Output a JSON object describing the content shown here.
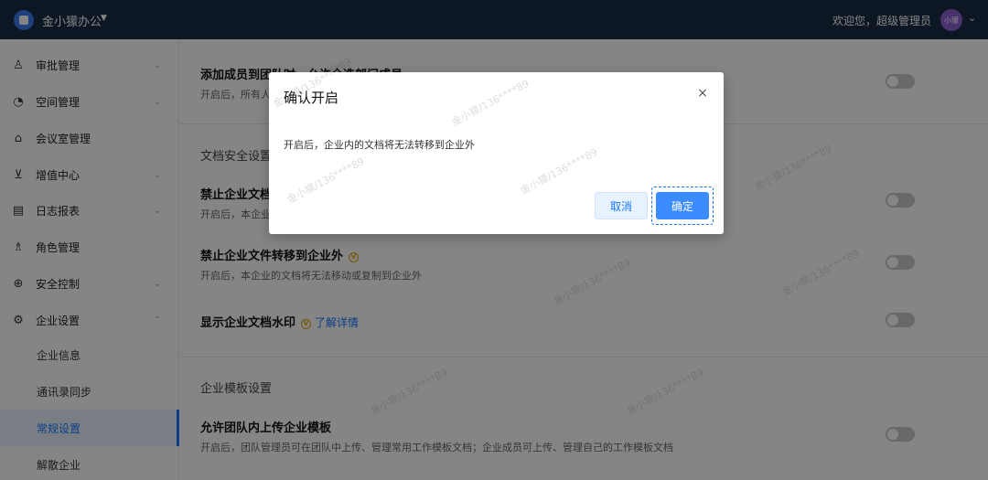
{
  "topbar": {
    "brand": "金小獴办公",
    "caret": "▼",
    "welcome": "欢迎您，超级管理员",
    "avatar_text": "小獴",
    "avatar_caret": "⌄"
  },
  "sidebar": {
    "items": [
      {
        "label": "审批管理",
        "icon": "person-icon",
        "glyph": "♙",
        "arrow": "⌄"
      },
      {
        "label": "空间管理",
        "icon": "pie-chart-icon",
        "glyph": "◔",
        "arrow": "⌄"
      },
      {
        "label": "会议室管理",
        "icon": "home-icon",
        "glyph": "⌂",
        "arrow": ""
      },
      {
        "label": "增值中心",
        "icon": "cart-icon",
        "glyph": "⊻",
        "arrow": "⌄"
      },
      {
        "label": "日志报表",
        "icon": "document-icon",
        "glyph": "▤",
        "arrow": "⌄"
      },
      {
        "label": "角色管理",
        "icon": "users-icon",
        "glyph": "♗",
        "arrow": ""
      },
      {
        "label": "安全控制",
        "icon": "compass-icon",
        "glyph": "⊕",
        "arrow": "⌄"
      },
      {
        "label": "企业设置",
        "icon": "gear-icon",
        "glyph": "⚙",
        "arrow": "⌃"
      }
    ],
    "sub_items": [
      {
        "label": "企业信息"
      },
      {
        "label": "通讯录同步"
      },
      {
        "label": "常规设置"
      },
      {
        "label": "解散企业"
      }
    ]
  },
  "main": {
    "row1_title": "添加成员到团队时，允许全选部门成员",
    "row1_desc": "开启后，所有人",
    "section_doc": "文档安全设置",
    "row2_title": "禁止企业文档",
    "row2_desc": "开启后，本企业",
    "row3_title": "禁止企业文件转移到企业外",
    "row3_vip": "V",
    "row3_desc": "开启后，本企业的文档将无法移动或复制到企业外",
    "row4_title": "显示企业文档水印",
    "row4_vip": "V",
    "row4_link": "了解详情",
    "section_tpl": "企业模板设置",
    "row5_title": "允许团队内上传企业模板",
    "row5_desc": "开启后，团队管理员可在团队中上传、管理常用工作模板文档；企业成员可上传、管理自己的工作模板文档"
  },
  "watermark": "金小獴/136****89",
  "dialog": {
    "title": "确认开启",
    "close": "×",
    "body": "开启后，企业内的文档将无法转移到企业外",
    "cancel": "取消",
    "confirm": "确定"
  },
  "colors": {
    "topbar": "#1a2b44",
    "accent": "#1677ff",
    "confirm_button": "#3b8cff",
    "toggle_off": "#c9c9c9"
  }
}
